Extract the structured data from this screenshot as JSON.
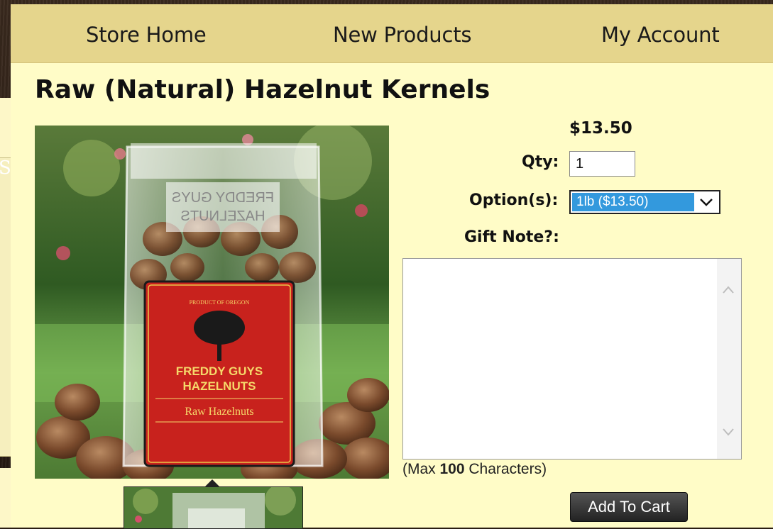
{
  "nav": {
    "items": [
      {
        "label": "Store Home"
      },
      {
        "label": "New Products"
      },
      {
        "label": "My Account"
      }
    ]
  },
  "product": {
    "title": "Raw (Natural) Hazelnut Kernels",
    "price": "$13.50",
    "image": {
      "label_top": "PRODUCT OF OREGON",
      "brand_line1": "FREDDY GUYS",
      "brand_line2": "HAZELNUTS",
      "variety": "Raw Hazelnuts",
      "bag_print_line1": "FREDDY GUYS",
      "bag_print_line2": "HAZELNUTS"
    }
  },
  "form": {
    "qty_label": "Qty:",
    "qty_value": "1",
    "options_label": "Option(s):",
    "option_selected": "1lb ($13.50)",
    "gift_label": "Gift Note?:",
    "gift_value": "",
    "max_prefix": "(Max ",
    "max_count": "100",
    "max_suffix": " Characters)",
    "add_to_cart": "Add To Cart"
  },
  "sidebar": {
    "partial_char": "S"
  },
  "colors": {
    "nav_bg": "#e5d58c",
    "page_bg": "#fffcc7",
    "select_highlight": "#3399dd",
    "label_red": "#c8221d"
  }
}
